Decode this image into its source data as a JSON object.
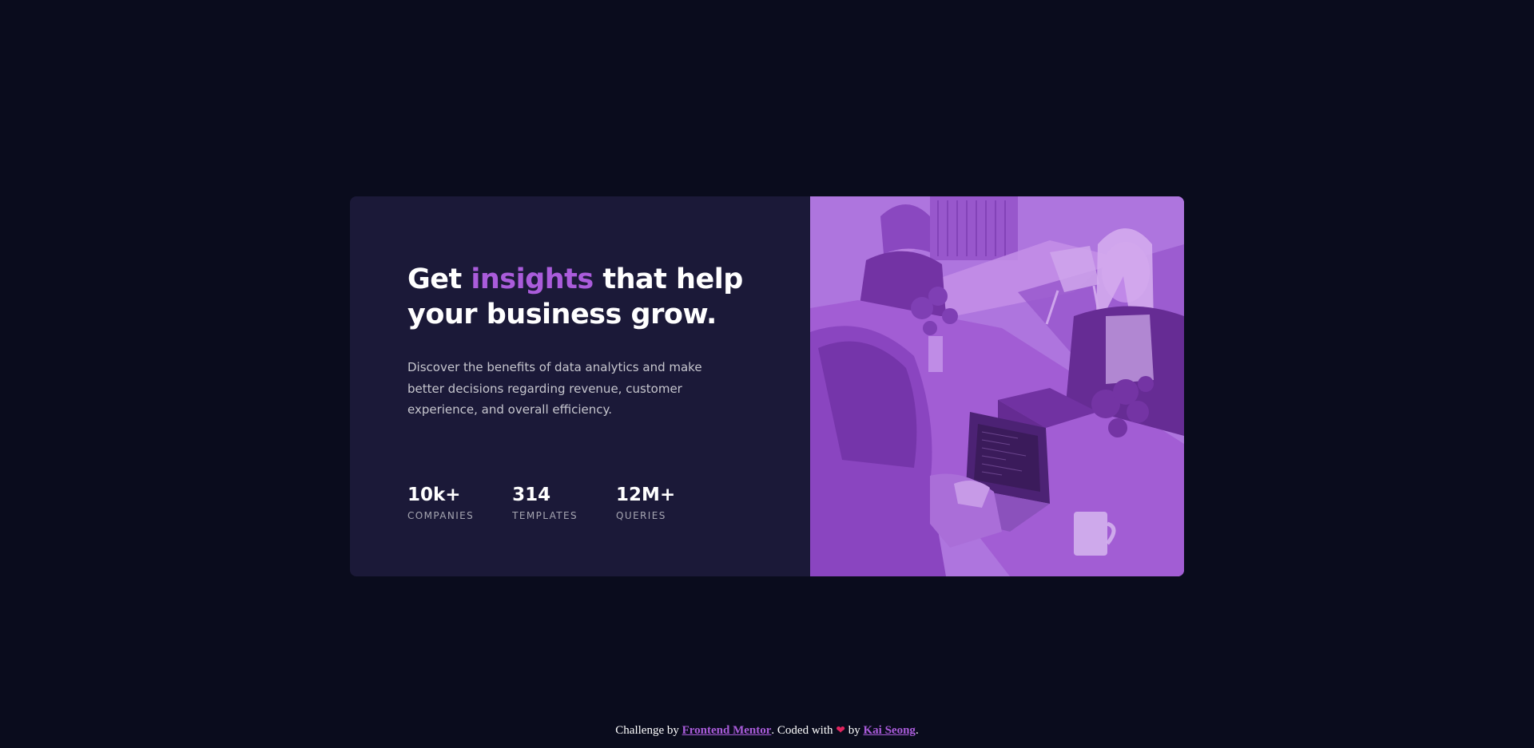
{
  "card": {
    "headline": {
      "before": "Get ",
      "accent": "insights",
      "after": " that help your business grow."
    },
    "description": "Discover the benefits of data analytics and make better decisions regarding revenue, customer experience, and overall efficiency.",
    "stats": [
      {
        "value": "10k+",
        "label": "COMPANIES"
      },
      {
        "value": "314",
        "label": "TEMPLATES"
      },
      {
        "value": "12M+",
        "label": "QUERIES"
      }
    ],
    "image_alt": "people working at desks"
  },
  "footer": {
    "prefix": "Challenge by ",
    "mentor_link": "Frontend Mentor",
    "middle": ". Coded with ",
    "heart_icon": "❤",
    "by": " by ",
    "author_link": "Kai Seong",
    "suffix": "."
  },
  "colors": {
    "page_bg": "#0a0c1d",
    "card_bg": "#1b1938",
    "accent": "#aa5cdb",
    "image_tint": "#a35bd8"
  }
}
